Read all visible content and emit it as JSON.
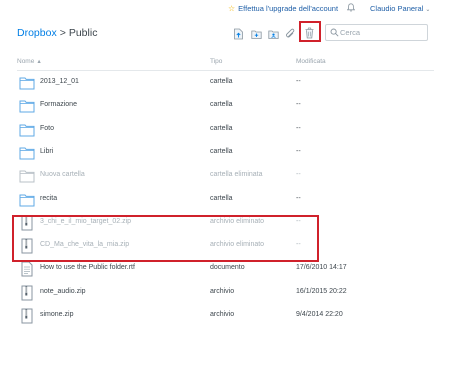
{
  "topbar": {
    "upgrade_label": "Effettua l'upgrade dell'account",
    "user_name": "Claudio Paneral"
  },
  "breadcrumb": {
    "root": "Dropbox",
    "separator": ">",
    "current": "Public"
  },
  "search": {
    "placeholder": "Cerca"
  },
  "columns": {
    "name": "Nome",
    "type": "Tipo",
    "modified": "Modificata"
  },
  "rows": [
    {
      "name": "2013_12_01",
      "type": "cartella",
      "modified": "--",
      "icon": "folder-icon"
    },
    {
      "name": "Formazione",
      "type": "cartella",
      "modified": "--",
      "icon": "folder-icon"
    },
    {
      "name": "Foto",
      "type": "cartella",
      "modified": "--",
      "icon": "folder-icon"
    },
    {
      "name": "Libri",
      "type": "cartella",
      "modified": "--",
      "icon": "folder-icon"
    },
    {
      "name": "Nuova cartella",
      "type": "cartella eliminata",
      "modified": "--",
      "icon": "deleted-folder-icon"
    },
    {
      "name": "recita",
      "type": "cartella",
      "modified": "--",
      "icon": "folder-icon"
    },
    {
      "name": "3_chi_e_il_mio_target_02.zip",
      "type": "archivio eliminato",
      "modified": "--",
      "icon": "zip-icon"
    },
    {
      "name": "CD_Ma_che_vita_la_mia.zip",
      "type": "archivio eliminato",
      "modified": "--",
      "icon": "zip-icon"
    },
    {
      "name": "How to use the Public folder.rtf",
      "type": "documento",
      "modified": "17/6/2010 14:17",
      "icon": "document-icon"
    },
    {
      "name": "note_audio.zip",
      "type": "archivio",
      "modified": "16/1/2015 20:22",
      "icon": "zip-icon"
    },
    {
      "name": "simone.zip",
      "type": "archivio",
      "modified": "9/4/2014 22:20",
      "icon": "zip-icon"
    }
  ],
  "colors": {
    "accent": "#007ee5",
    "highlight": "#d0212b",
    "folder": "#5fa9e6"
  }
}
